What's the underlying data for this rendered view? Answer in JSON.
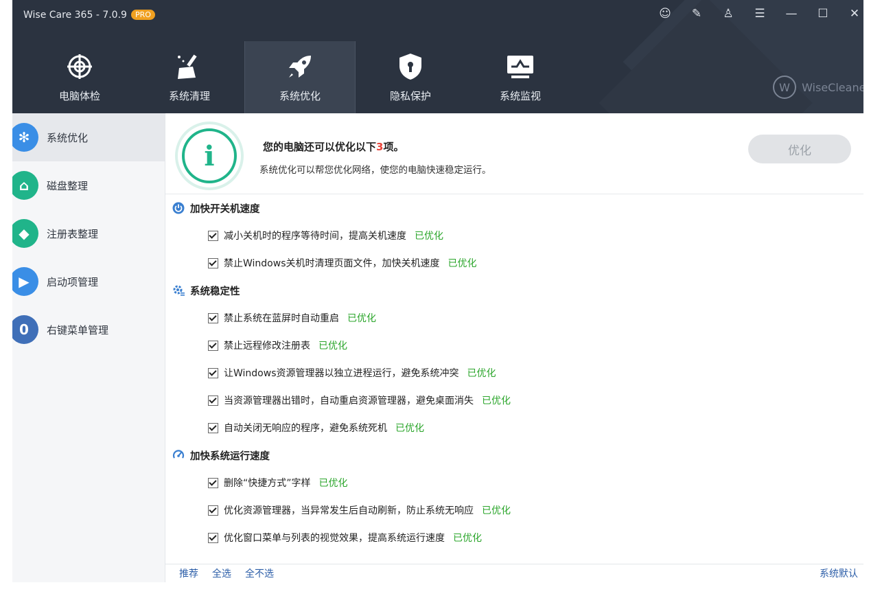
{
  "app": {
    "title": "Wise Care 365 - 7.0.9",
    "badge": "PRO",
    "brand": "WiseCleaner"
  },
  "window_controls": [
    "robot-icon",
    "notes-icon",
    "shirt-icon",
    "menu-icon",
    "minimize-icon",
    "maximize-icon",
    "close-icon"
  ],
  "nav": [
    {
      "label": "电脑体检",
      "icon": "target-icon"
    },
    {
      "label": "系统清理",
      "icon": "broom-icon"
    },
    {
      "label": "系统优化",
      "icon": "rocket-icon",
      "active": true
    },
    {
      "label": "隐私保护",
      "icon": "shield-icon"
    },
    {
      "label": "系统监视",
      "icon": "monitor-icon"
    }
  ],
  "sidebar": [
    {
      "label": "系统优化",
      "color": "#3a8ee6",
      "glyph": "✻",
      "active": true
    },
    {
      "label": "磁盘整理",
      "color": "#20b48a",
      "glyph": "⌂"
    },
    {
      "label": "注册表整理",
      "color": "#20b48a",
      "glyph": "◆"
    },
    {
      "label": "启动项管理",
      "color": "#3a8ee6",
      "glyph": "▶"
    },
    {
      "label": "右键菜单管理",
      "color": "#3f6fb8",
      "glyph": "0"
    }
  ],
  "summary": {
    "title_prefix": "您的电脑还可以优化以下",
    "count": "3",
    "title_suffix": "项。",
    "subtitle": "系统优化可以帮您优化网络，使您的电脑快速稳定运行。",
    "button": "优化"
  },
  "sections": [
    {
      "title": "加快开关机速度",
      "items": [
        {
          "text": "减小关机时的程序等待时间，提高关机速度",
          "status": "已优化"
        },
        {
          "text": "禁止Windows关机时清理页面文件，加快关机速度",
          "status": "已优化"
        }
      ]
    },
    {
      "title": "系统稳定性",
      "items": [
        {
          "text": "禁止系统在蓝屏时自动重启",
          "status": "已优化"
        },
        {
          "text": "禁止远程修改注册表",
          "status": "已优化"
        },
        {
          "text": "让Windows资源管理器以独立进程运行，避免系统冲突",
          "status": "已优化"
        },
        {
          "text": "当资源管理器出错时，自动重启资源管理器，避免桌面消失",
          "status": "已优化"
        },
        {
          "text": "自动关闭无响应的程序，避免系统死机",
          "status": "已优化"
        }
      ]
    },
    {
      "title": "加快系统运行速度",
      "items": [
        {
          "text": "删除“快捷方式”字样",
          "status": "已优化"
        },
        {
          "text": "优化资源管理器，当异常发生后自动刷新，防止系统无响应",
          "status": "已优化"
        },
        {
          "text": "优化窗口菜单与列表的视觉效果，提高系统运行速度",
          "status": "已优化"
        }
      ]
    }
  ],
  "footer": {
    "recommend": "推荐",
    "select_all": "全选",
    "select_none": "全不选",
    "defaults": "系统默认"
  }
}
